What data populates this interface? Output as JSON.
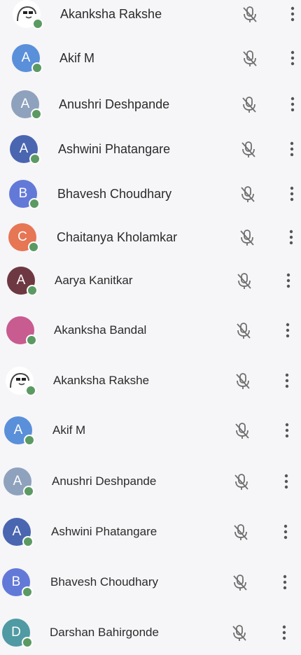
{
  "colors": {
    "background": "#f6f5f8",
    "online_dot": "#5c9a63",
    "icon_muted": "#6f6f6f",
    "text": "#2b2b2b"
  },
  "participants": [
    {
      "name": "Akanksha Rakshe",
      "initial": "",
      "avatar_color": "#ffffff",
      "avatar_kind": "memoji-icon"
    },
    {
      "name": "Akif M",
      "initial": "A",
      "avatar_color": "#5a8fda",
      "avatar_kind": "initial"
    },
    {
      "name": "Anushri Deshpande",
      "initial": "A",
      "avatar_color": "#8ea2bd",
      "avatar_kind": "initial"
    },
    {
      "name": "Ashwini Phatangare",
      "initial": "A",
      "avatar_color": "#4a66b0",
      "avatar_kind": "initial"
    },
    {
      "name": "Bhavesh Choudhary",
      "initial": "B",
      "avatar_color": "#6379d8",
      "avatar_kind": "initial"
    },
    {
      "name": "Chaitanya Kholamkar",
      "initial": "C",
      "avatar_color": "#e67654",
      "avatar_kind": "initial"
    },
    {
      "name": "Aarya Kanitkar",
      "initial": "A",
      "avatar_color": "#6e3842",
      "avatar_kind": "initial"
    },
    {
      "name": "Akanksha Bandal",
      "initial": "",
      "avatar_color": "#c85b8f",
      "avatar_kind": "girl-photo-icon"
    },
    {
      "name": "Akanksha Rakshe",
      "initial": "",
      "avatar_color": "#ffffff",
      "avatar_kind": "memoji-icon"
    },
    {
      "name": "Akif M",
      "initial": "A",
      "avatar_color": "#5a8fda",
      "avatar_kind": "initial"
    },
    {
      "name": "Anushri Deshpande",
      "initial": "A",
      "avatar_color": "#8ea2bd",
      "avatar_kind": "initial"
    },
    {
      "name": "Ashwini Phatangare",
      "initial": "A",
      "avatar_color": "#4a66b0",
      "avatar_kind": "initial"
    },
    {
      "name": "Bhavesh Choudhary",
      "initial": "B",
      "avatar_color": "#6379d8",
      "avatar_kind": "initial"
    },
    {
      "name": "Darshan Bahirgonde",
      "initial": "D",
      "avatar_color": "#4f9aa3",
      "avatar_kind": "initial"
    }
  ],
  "icons": {
    "mic": "mic-off-icon",
    "more": "more-vert-icon"
  }
}
